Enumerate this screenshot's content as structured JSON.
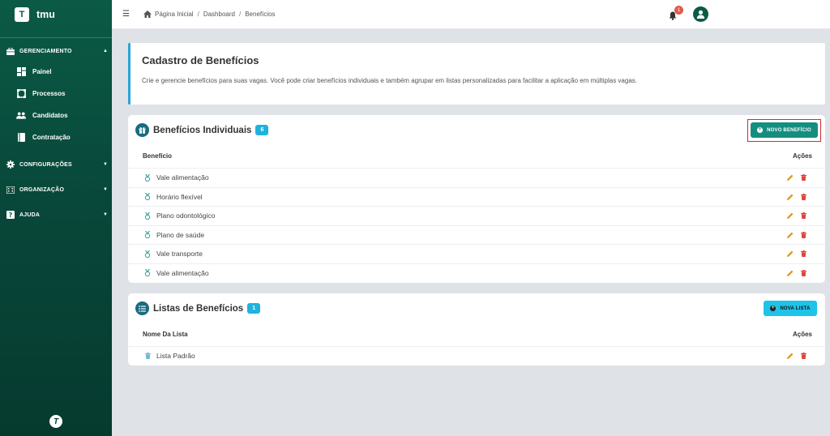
{
  "app": {
    "logo_letter": "T",
    "name": "tmu",
    "footer_logo": "T"
  },
  "sidebar": {
    "sections": [
      {
        "label": "GERENCIAMENTO",
        "icon": "briefcase-icon",
        "expanded": true,
        "items": [
          {
            "label": "Painel",
            "icon": "dashboard-icon"
          },
          {
            "label": "Processos",
            "icon": "process-icon"
          },
          {
            "label": "Candidatos",
            "icon": "people-icon"
          },
          {
            "label": "Contratação",
            "icon": "book-icon"
          }
        ]
      },
      {
        "label": "CONFIGURAÇÕES",
        "icon": "gear-icon",
        "expanded": false
      },
      {
        "label": "ORGANIZAÇÃO",
        "icon": "building-icon",
        "expanded": false
      },
      {
        "label": "AJUDA",
        "icon": "help-icon",
        "expanded": false
      }
    ]
  },
  "topbar": {
    "breadcrumb": [
      "Página Inicial",
      "Dashboard",
      "Benefícios"
    ],
    "notification_count": "1"
  },
  "intro": {
    "title": "Cadastro de Benefícios",
    "description": "Crie e gerencie benefícios para suas vagas. Você pode criar benefícios individuais e também agrupar em listas personalizadas para facilitar a aplicação em múltiplas vagas."
  },
  "individual": {
    "title": "Benefícios Individuais",
    "count": "6",
    "button": "NOVO BENEFÍCIO",
    "col_name": "Benefício",
    "col_actions": "Ações",
    "rows": [
      "Vale alimentação",
      "Horário flexível",
      "Plano odontológico",
      "Plano de saúde",
      "Vale transporte",
      "Vale alimentação"
    ]
  },
  "lists": {
    "title": "Listas de Benefícios",
    "count": "1",
    "button": "NOVA LISTA",
    "col_name": "Nome Da Lista",
    "col_actions": "Ações",
    "rows": [
      "Lista Padrão"
    ]
  },
  "colors": {
    "sidebar": "#0b5a46",
    "accent_teal": "#148f7f",
    "accent_cyan": "#1ec3e8",
    "edit": "#d99a1b",
    "delete": "#e0413a",
    "highlight": "#d62a2a"
  }
}
